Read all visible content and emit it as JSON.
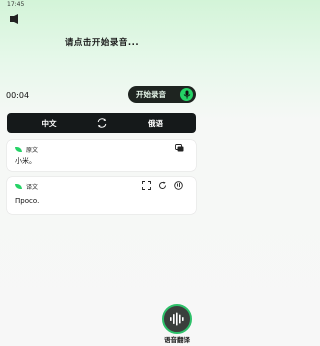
{
  "status_bar": {
    "time": "17:45"
  },
  "prompt": "请点击开始录音...",
  "timer": "00:04",
  "record_button": {
    "label": "开始录音"
  },
  "languages": {
    "source": "中文",
    "target": "俄语"
  },
  "source_card": {
    "title": "原文",
    "text": "小米。"
  },
  "translation_card": {
    "title": "译文",
    "text": "Просо."
  },
  "voice_translate": {
    "label": "语音翻译"
  },
  "colors": {
    "accent": "#25d366",
    "dark": "#15191a"
  }
}
